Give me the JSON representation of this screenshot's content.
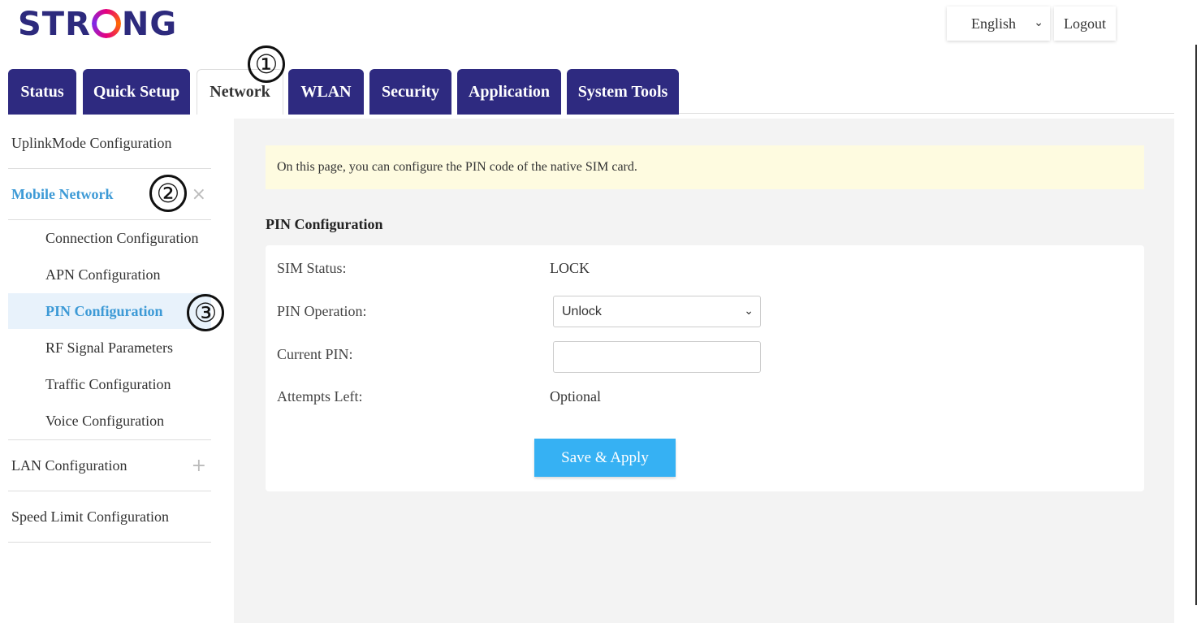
{
  "brand": {
    "logo_prefix": "STR",
    "logo_suffix": "NG"
  },
  "header": {
    "language": "English",
    "logout_label": "Logout"
  },
  "tabs": [
    {
      "label": "Status"
    },
    {
      "label": "Quick Setup"
    },
    {
      "label": "Network",
      "active": true
    },
    {
      "label": "WLAN"
    },
    {
      "label": "Security"
    },
    {
      "label": "Application"
    },
    {
      "label": "System Tools"
    }
  ],
  "annotations": [
    "①",
    "②",
    "③"
  ],
  "sidebar": {
    "uplink": "UplinkMode Configuration",
    "mobile_network": "Mobile Network",
    "mobile_network_icon": "×",
    "sub_items": [
      "Connection Configuration",
      "APN Configuration",
      "PIN Configuration",
      "RF Signal Parameters",
      "Traffic Configuration",
      "Voice Configuration"
    ],
    "lan": "LAN Configuration",
    "lan_icon": "+",
    "speed_limit": "Speed Limit Configuration"
  },
  "main": {
    "notice": "On this page, you can configure the PIN code of the native SIM card.",
    "section_title": "PIN Configuration",
    "sim_status_label": "SIM Status:",
    "sim_status_value": "LOCK",
    "pin_operation_label": "PIN Operation:",
    "pin_operation_value": "Unlock",
    "current_pin_label": "Current PIN:",
    "current_pin_value": "",
    "attempts_left_label": "Attempts Left:",
    "attempts_left_value": "Optional",
    "save_label": "Save & Apply"
  },
  "colors": {
    "tab_bg": "#2e2a80",
    "accent": "#3d9ad6",
    "button": "#36b1f3",
    "notice_bg": "#fefbe0"
  }
}
